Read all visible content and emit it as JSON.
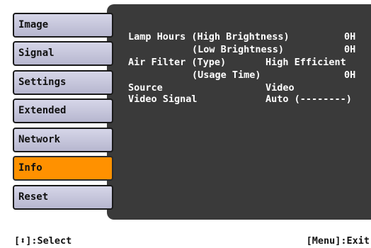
{
  "menu": {
    "items": [
      {
        "label": "Image"
      },
      {
        "label": "Signal"
      },
      {
        "label": "Settings"
      },
      {
        "label": "Extended"
      },
      {
        "label": "Network"
      },
      {
        "label": "Info"
      },
      {
        "label": "Reset"
      }
    ],
    "active_label": "Info"
  },
  "info": {
    "lamp_hours_label": "Lamp Hours (High Brightness)",
    "lamp_hours_high_value": "0H",
    "low_brightness_label": "(Low Brightness)",
    "lamp_hours_low_value": "0H",
    "air_filter_type_label": "Air Filter (Type)",
    "air_filter_type_value": "High Efficient",
    "usage_time_label": "(Usage Time)",
    "usage_time_value": "0H",
    "source_label": "Source",
    "source_value": "Video",
    "video_signal_label": "Video Signal",
    "video_signal_value": "Auto (--------)"
  },
  "footer": {
    "select_hint": "[⬍]:Select",
    "exit_hint": "[Menu]:Exit"
  },
  "colors": {
    "active_item": "#ff9100",
    "panel_background": "#3a3a3a",
    "menu_item_background": "#c8c8dc"
  }
}
